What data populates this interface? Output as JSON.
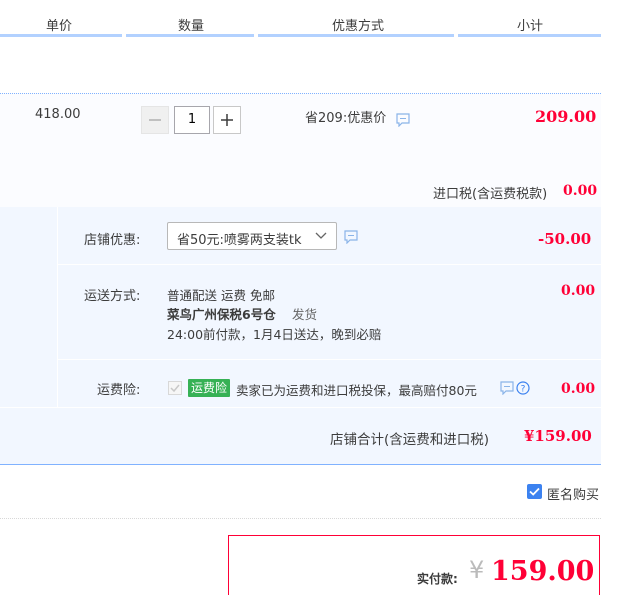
{
  "header": {
    "col_price": "单价",
    "col_qty": "数量",
    "col_discount": "优惠方式",
    "col_subtotal": "小计"
  },
  "item": {
    "price": "418.00",
    "quantity": "1",
    "discount_text": "省209:优惠价",
    "subtotal": "209.00",
    "tax_label": "进口税(含运费税款)",
    "tax_value": "0.00"
  },
  "shop": {
    "coupon_label": "店铺优惠:",
    "coupon_selected": "省50元:喷雾两支装tk",
    "coupon_value": "-50.00",
    "shipping_label": "运送方式:",
    "shipping_method": "普通配送 运费 免邮",
    "warehouse": "菜鸟广州保税6号仓",
    "ship_word": "发货",
    "delivery_note": "24:00前付款，1月4日送达，晚到必赔",
    "shipping_value": "0.00",
    "insurance_label": "运费险:",
    "insurance_tag": "运费险",
    "insurance_desc": "卖家已为运费和进口税投保，最高赔付80元",
    "insurance_value": "0.00",
    "total_label": "店铺合计(含运费和进口税)",
    "total_value": "¥159.00"
  },
  "anonymous": {
    "label": "匿名购买",
    "checked": true
  },
  "pay": {
    "label": "实付款:",
    "currency": "¥",
    "amount": "159.00"
  },
  "colors": {
    "accent_red": "#ff0036",
    "accent_blue": "#3c82f0",
    "tag_green": "#36b155"
  }
}
